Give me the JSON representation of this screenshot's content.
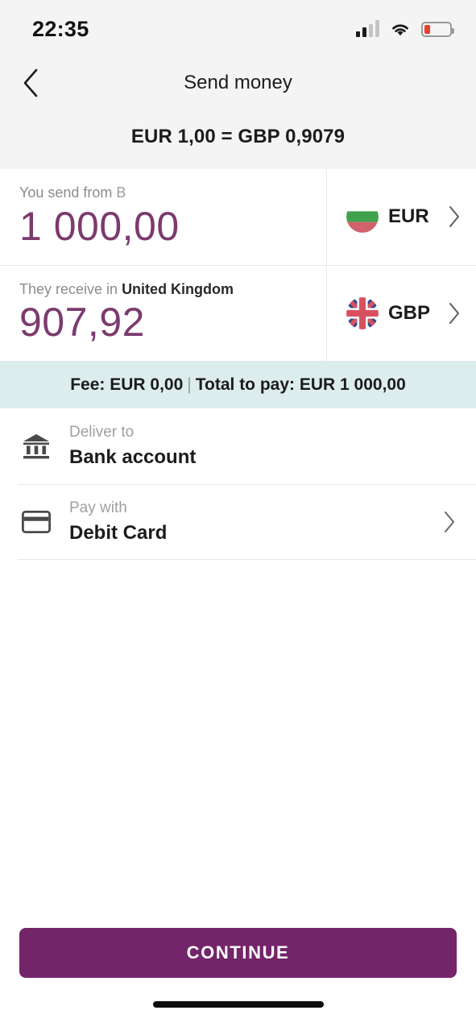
{
  "status_bar": {
    "time": "22:35",
    "signal_icon": "signal-bars-icon",
    "signal_bars_filled": 2,
    "signal_bars_total": 4,
    "wifi_icon": "wifi-icon",
    "battery_icon": "battery-low-icon",
    "battery_level_percent": 22,
    "battery_color": "#e8402a"
  },
  "header": {
    "back_icon": "chevron-left-icon",
    "title": "Send money",
    "exchange_rate": "EUR 1,00 = GBP 0,9079"
  },
  "send": {
    "caption_prefix": "You send from ",
    "caption_country": "B",
    "amount": "1 000,00",
    "currency_code": "EUR",
    "flag_icon": "bulgaria-flag-icon",
    "chevron_icon": "chevron-right-icon"
  },
  "receive": {
    "caption_prefix": "They receive in ",
    "caption_country": "United Kingdom",
    "amount": "907,92",
    "currency_code": "GBP",
    "flag_icon": "united-kingdom-flag-icon",
    "chevron_icon": "chevron-right-icon"
  },
  "fee_bar": {
    "fee_text": "Fee: EUR 0,00",
    "separator": "|",
    "total_text": "Total to pay: EUR 1 000,00",
    "background_color": "#ddeced"
  },
  "options": [
    {
      "caption": "Deliver to",
      "value": "Bank account",
      "icon": "bank-icon",
      "has_chevron": false
    },
    {
      "caption": "Pay with",
      "value": "Debit Card",
      "icon": "credit-card-icon",
      "has_chevron": true
    }
  ],
  "footer": {
    "continue_label": "CONTINUE",
    "continue_color": "#74256a"
  },
  "colors": {
    "amount_text": "#7c3a6e",
    "header_background": "#f4f4f4"
  }
}
